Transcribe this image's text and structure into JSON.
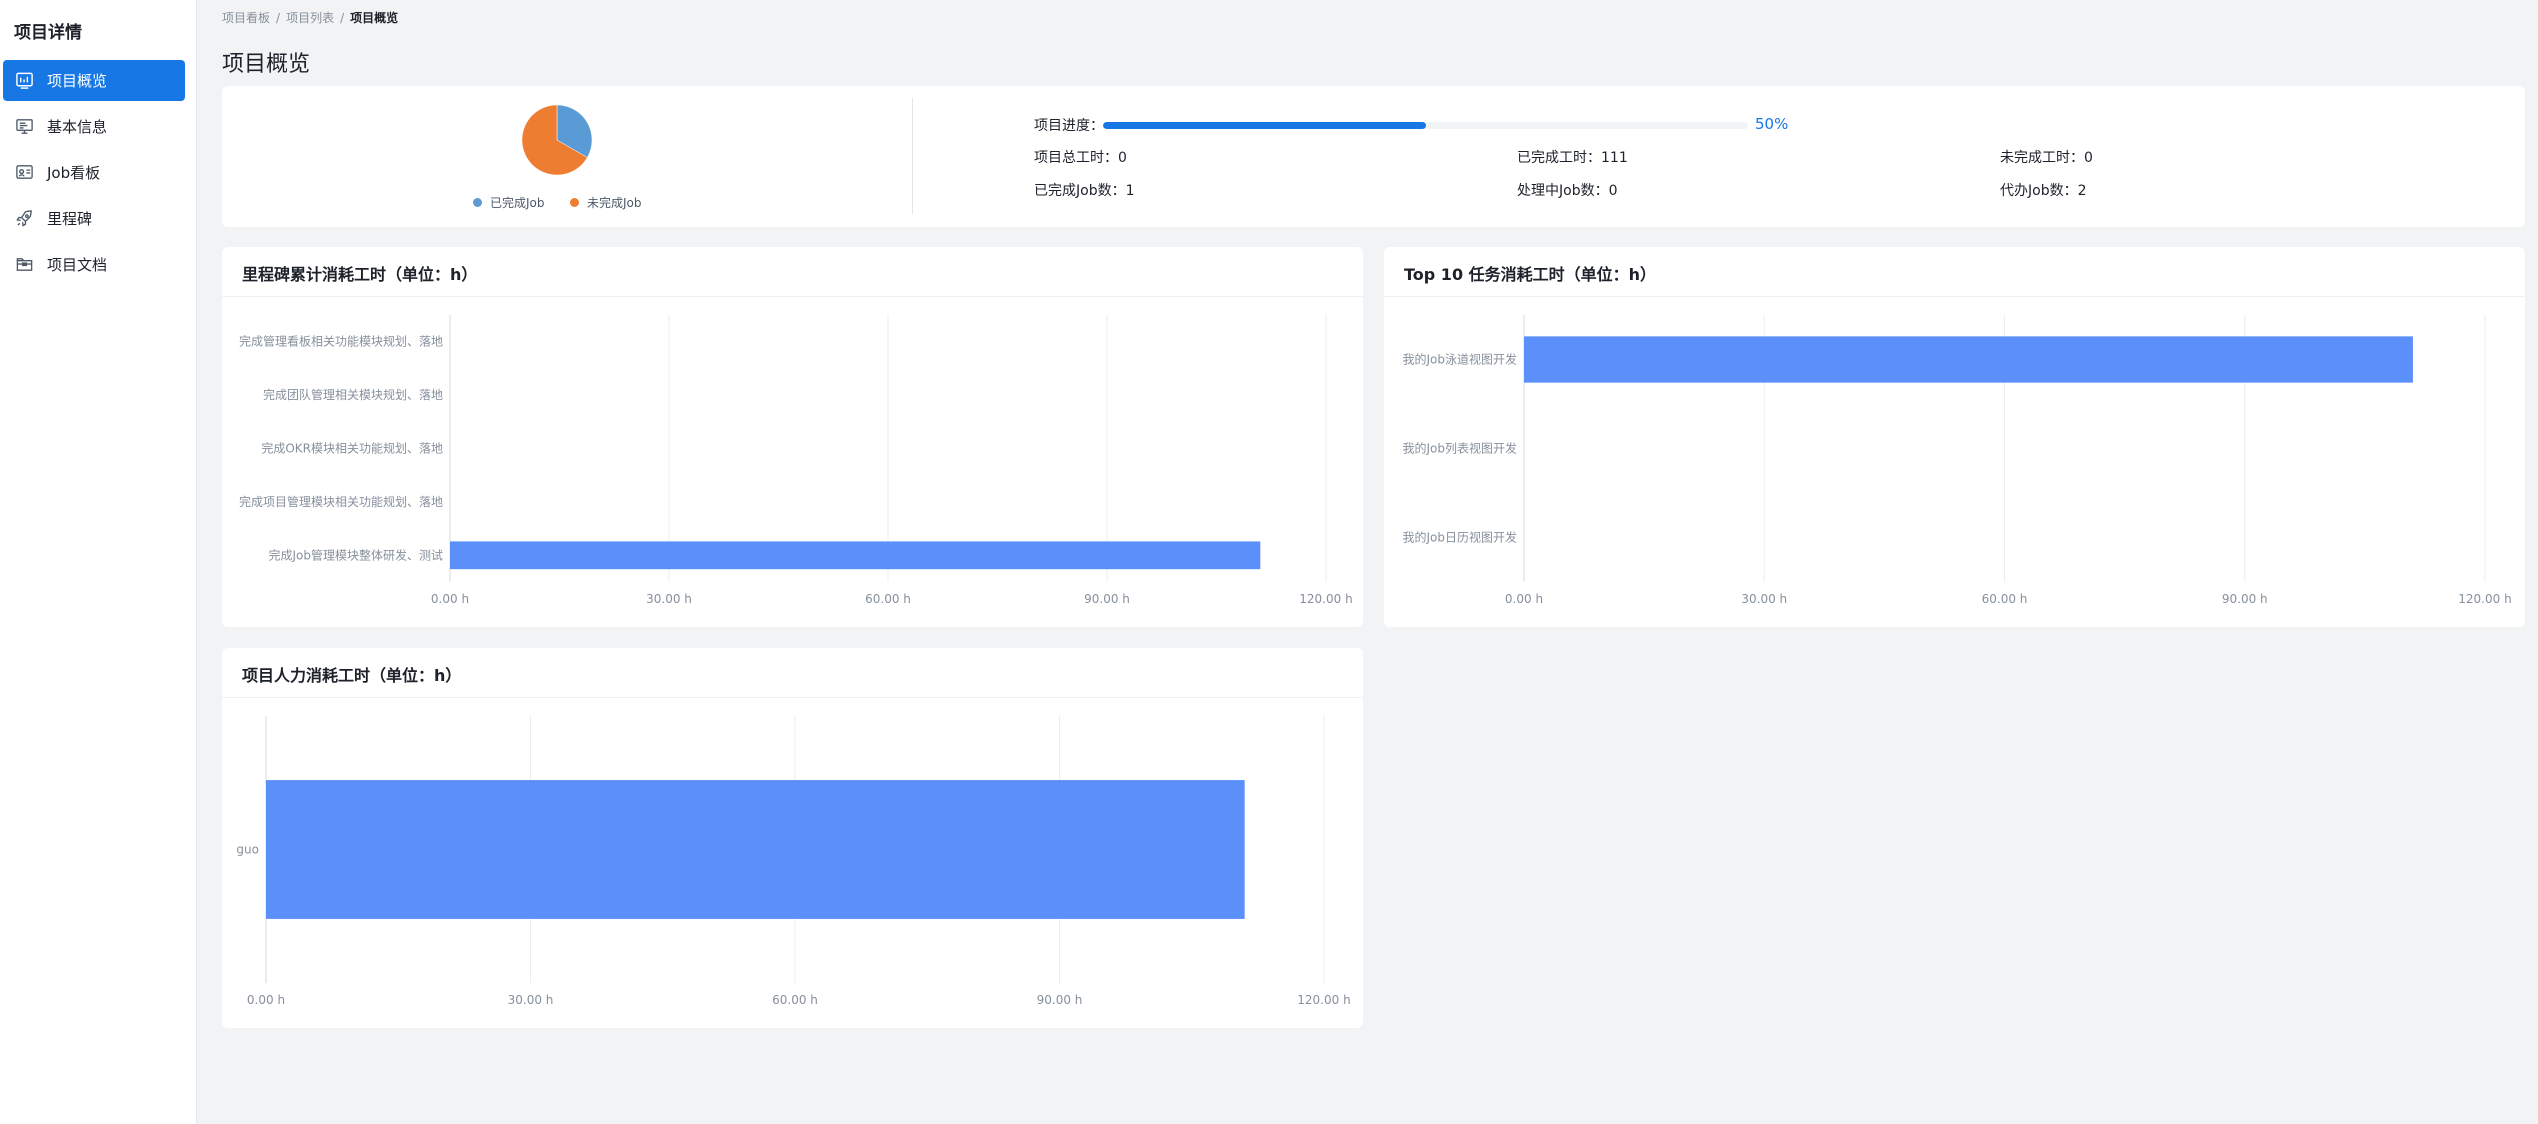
{
  "sidebar": {
    "title": "项目详情",
    "items": [
      {
        "label": "项目概览",
        "icon": "dashboard-icon",
        "active": true
      },
      {
        "label": "基本信息",
        "icon": "info-monitor-icon",
        "active": false
      },
      {
        "label": "Job看板",
        "icon": "kanban-icon",
        "active": false
      },
      {
        "label": "里程碑",
        "icon": "rocket-icon",
        "active": false
      },
      {
        "label": "项目文档",
        "icon": "folder-icon",
        "active": false
      }
    ]
  },
  "breadcrumb": {
    "items": [
      "项目看板",
      "项目列表",
      "项目概览"
    ],
    "separator": "/"
  },
  "page_title": "项目概览",
  "overview": {
    "legend": [
      {
        "label": "已完成Job",
        "color": "#5b9bd5"
      },
      {
        "label": "未完成Job",
        "color": "#ed7d31"
      }
    ],
    "progress_label": "项目进度：",
    "progress_value": 0.5,
    "progress_text": "50%",
    "stats": {
      "total_hours": "项目总工时：0",
      "done_hours": "已完成工时：111",
      "undone_hours": "未完成工时：0",
      "done_jobs": "已完成Job数：1",
      "doing_jobs": "处理中Job数：0",
      "todo_jobs": "代办Job数：2"
    }
  },
  "charts": {
    "milestone_title": "里程碑累计消耗工时（单位：h）",
    "top10_title": "Top 10 任务消耗工时（单位：h）",
    "people_title": "项目人力消耗工时（单位：h）"
  },
  "chart_data": [
    {
      "type": "pie",
      "categories": [
        "已完成Job",
        "未完成Job"
      ],
      "values": [
        1,
        2
      ],
      "colors": [
        "#5b9bd5",
        "#ed7d31"
      ],
      "legend": "bottom"
    },
    {
      "type": "bar",
      "orientation": "horizontal",
      "title": "里程碑累计消耗工时（单位：h）",
      "categories": [
        "完成管理看板相关功能模块规划、落地",
        "完成团队管理相关模块规划、落地",
        "完成OKR模块相关功能规划、落地",
        "完成项目管理模块相关功能规划、落地",
        "完成Job管理模块整体研发、测试"
      ],
      "values": [
        0,
        0,
        0,
        0,
        111
      ],
      "xlim": [
        0,
        120
      ],
      "xticks": [
        "0.00 h",
        "30.00 h",
        "60.00 h",
        "90.00 h",
        "120.00 h"
      ],
      "color": "#5b8ff9",
      "grid": true
    },
    {
      "type": "bar",
      "orientation": "horizontal",
      "title": "Top 10 任务消耗工时（单位：h）",
      "categories": [
        "我的Job泳道视图开发",
        "我的Job列表视图开发",
        "我的Job日历视图开发"
      ],
      "values": [
        111,
        0,
        0
      ],
      "xlim": [
        0,
        120
      ],
      "xticks": [
        "0.00 h",
        "30.00 h",
        "60.00 h",
        "90.00 h",
        "120.00 h"
      ],
      "color": "#5b8ff9",
      "grid": true
    },
    {
      "type": "bar",
      "orientation": "horizontal",
      "title": "项目人力消耗工时（单位：h）",
      "categories": [
        "guo"
      ],
      "values": [
        111
      ],
      "xlim": [
        0,
        120
      ],
      "xticks": [
        "0.00 h",
        "30.00 h",
        "60.00 h",
        "90.00 h",
        "120.00 h"
      ],
      "color": "#5b8ff9",
      "grid": true
    }
  ]
}
